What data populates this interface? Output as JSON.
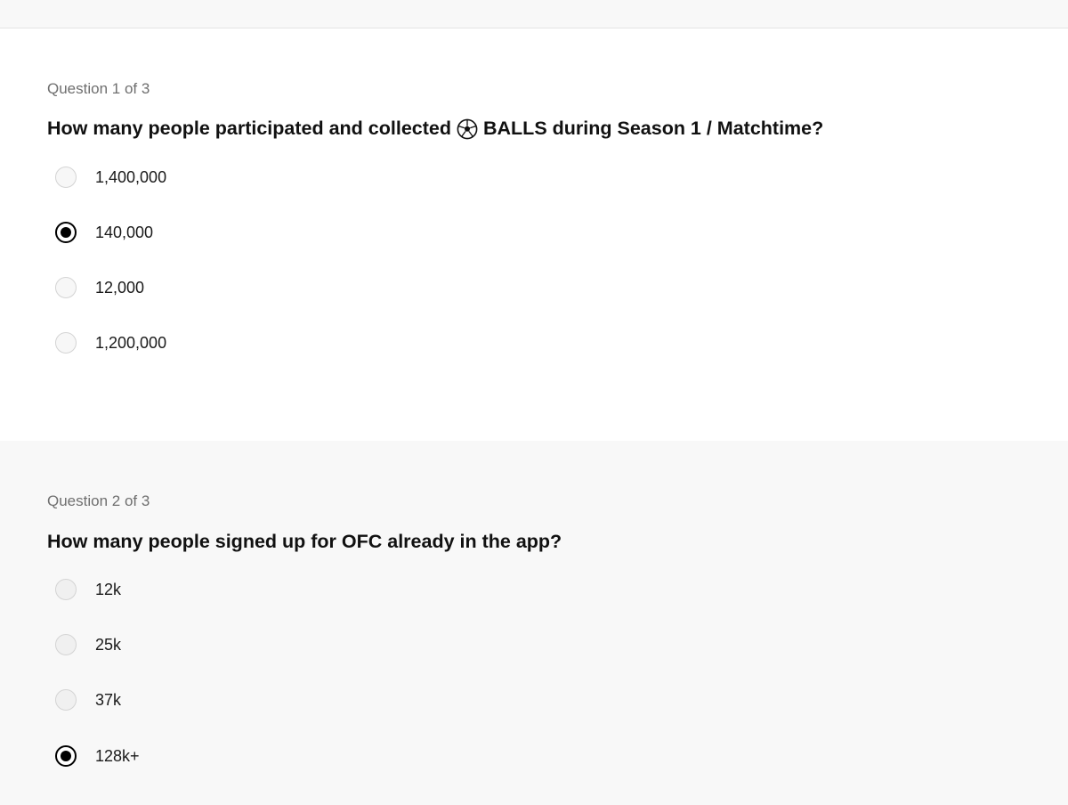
{
  "questions": [
    {
      "counter": "Question 1 of 3",
      "title_before_icon": "How many people participated and collected",
      "title_icon": "soccer-ball-icon",
      "title_after_icon": "BALLS during Season 1 / Matchtime?",
      "options": [
        {
          "label": "1,400,000",
          "selected": false
        },
        {
          "label": "140,000",
          "selected": true
        },
        {
          "label": "12,000",
          "selected": false
        },
        {
          "label": "1,200,000",
          "selected": false
        }
      ]
    },
    {
      "counter": "Question 2 of 3",
      "title": "How many people signed up for OFC already in the app?",
      "options": [
        {
          "label": "12k",
          "selected": false
        },
        {
          "label": "25k",
          "selected": false
        },
        {
          "label": "37k",
          "selected": false
        },
        {
          "label": "128k+",
          "selected": true
        }
      ]
    }
  ],
  "colors": {
    "page_background": "#ffffff",
    "alt_section_background": "#f8f8f8",
    "selected_radio": "#000000",
    "muted_text": "#6f6f6f"
  }
}
